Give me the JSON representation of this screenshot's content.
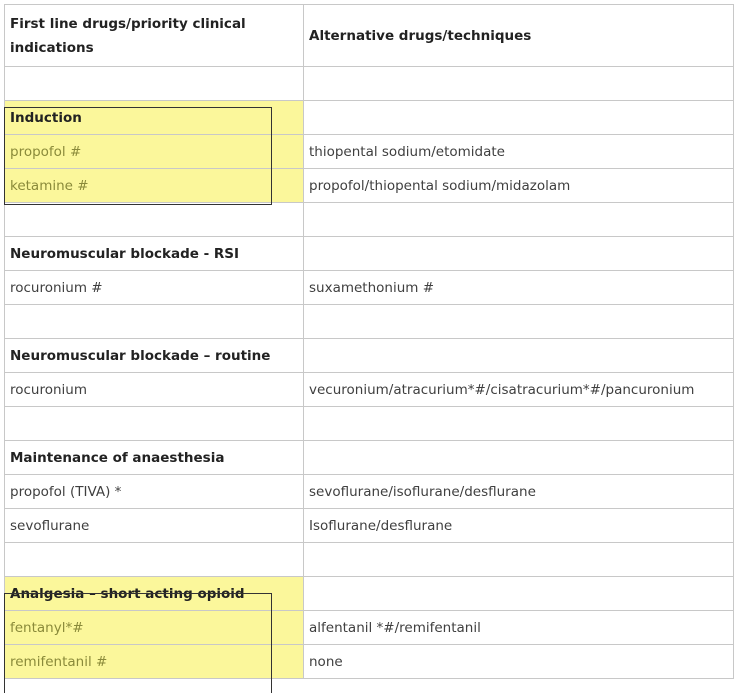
{
  "header": {
    "col1": "First line drugs/priority clinical indications",
    "col2": "Alternative drugs/techniques"
  },
  "rows": [
    {
      "c1": "",
      "c2": "",
      "type": "blank"
    },
    {
      "c1": "Induction",
      "c2": "",
      "type": "section",
      "highlight": true
    },
    {
      "c1": "propofol #",
      "c2": "thiopental sodium/etomidate",
      "type": "item",
      "highlight": true
    },
    {
      "c1": "ketamine #",
      "c2": "propofol/thiopental sodium/midazolam",
      "type": "item",
      "highlight": true
    },
    {
      "c1": "",
      "c2": "",
      "type": "blank"
    },
    {
      "c1": "Neuromuscular blockade - RSI",
      "c2": "",
      "type": "section"
    },
    {
      "c1": "rocuronium #",
      "c2": "suxamethonium #",
      "type": "item"
    },
    {
      "c1": "",
      "c2": "",
      "type": "blank"
    },
    {
      "c1": "Neuromuscular blockade – routine",
      "c2": "",
      "type": "section"
    },
    {
      "c1": "rocuronium",
      "c2": "vecuronium/atracurium*#/cisatracurium*#/pancuronium",
      "type": "item"
    },
    {
      "c1": "",
      "c2": "",
      "type": "blank"
    },
    {
      "c1": "Maintenance of anaesthesia",
      "c2": "",
      "type": "section"
    },
    {
      "c1": "propofol (TIVA) *",
      "c2": "sevoflurane/isoflurane/desflurane",
      "type": "item"
    },
    {
      "c1": "sevoflurane",
      "c2": "Isoflurane/desflurane",
      "type": "item"
    },
    {
      "c1": "",
      "c2": "",
      "type": "blank"
    },
    {
      "c1": "Analgesia – short acting opioid",
      "c2": "",
      "type": "section",
      "highlight": true
    },
    {
      "c1": "fentanyl*#",
      "c2": "alfentanil *#/remifentanil",
      "type": "item",
      "highlight": true
    },
    {
      "c1": "remifentanil #",
      "c2": "none",
      "type": "item",
      "highlight": true
    }
  ],
  "colors": {
    "highlight": "#fbf79b",
    "border": "#c8c8c8"
  }
}
